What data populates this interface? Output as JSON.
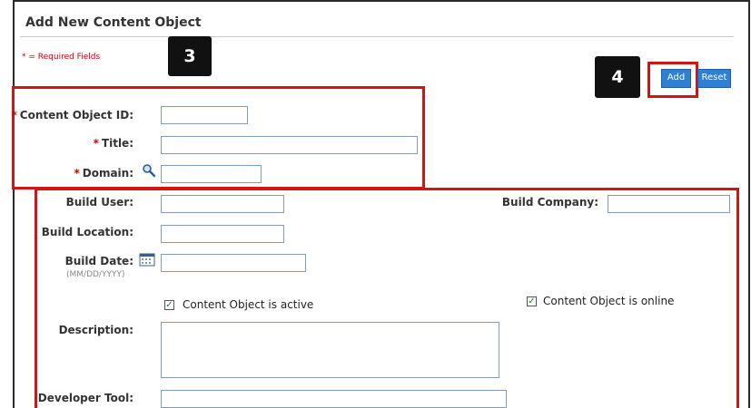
{
  "form": {
    "title": "Add New Content Object",
    "required_note": "* = Required Fields"
  },
  "badges": {
    "step3": "3",
    "step4": "4"
  },
  "buttons": {
    "add": "Add",
    "reset": "Reset"
  },
  "required_star": "*",
  "fields": {
    "content_object_id": {
      "label": "Content Object ID:",
      "value": ""
    },
    "title": {
      "label": "Title:",
      "value": ""
    },
    "domain": {
      "label": "Domain:",
      "value": ""
    },
    "build_user": {
      "label": "Build User:",
      "value": ""
    },
    "build_company": {
      "label": "Build Company:",
      "value": ""
    },
    "build_location": {
      "label": "Build Location:",
      "value": ""
    },
    "build_date": {
      "label": "Build Date:",
      "hint": "(MM/DD/YYYY)",
      "value": ""
    },
    "description": {
      "label": "Description:",
      "value": ""
    },
    "developer_tool": {
      "label": "Developer Tool:",
      "value": ""
    }
  },
  "checkboxes": {
    "active": {
      "label": "Content Object is active",
      "checked": true
    },
    "online": {
      "label": "Content Object is online",
      "checked": true
    }
  },
  "icons": {
    "domain_lookup": "magnifier-icon",
    "date_picker": "calendar-icon",
    "check": "✓"
  },
  "colors": {
    "required": "#d40000",
    "highlight": "#d31414",
    "button": "#2f7fd3"
  }
}
